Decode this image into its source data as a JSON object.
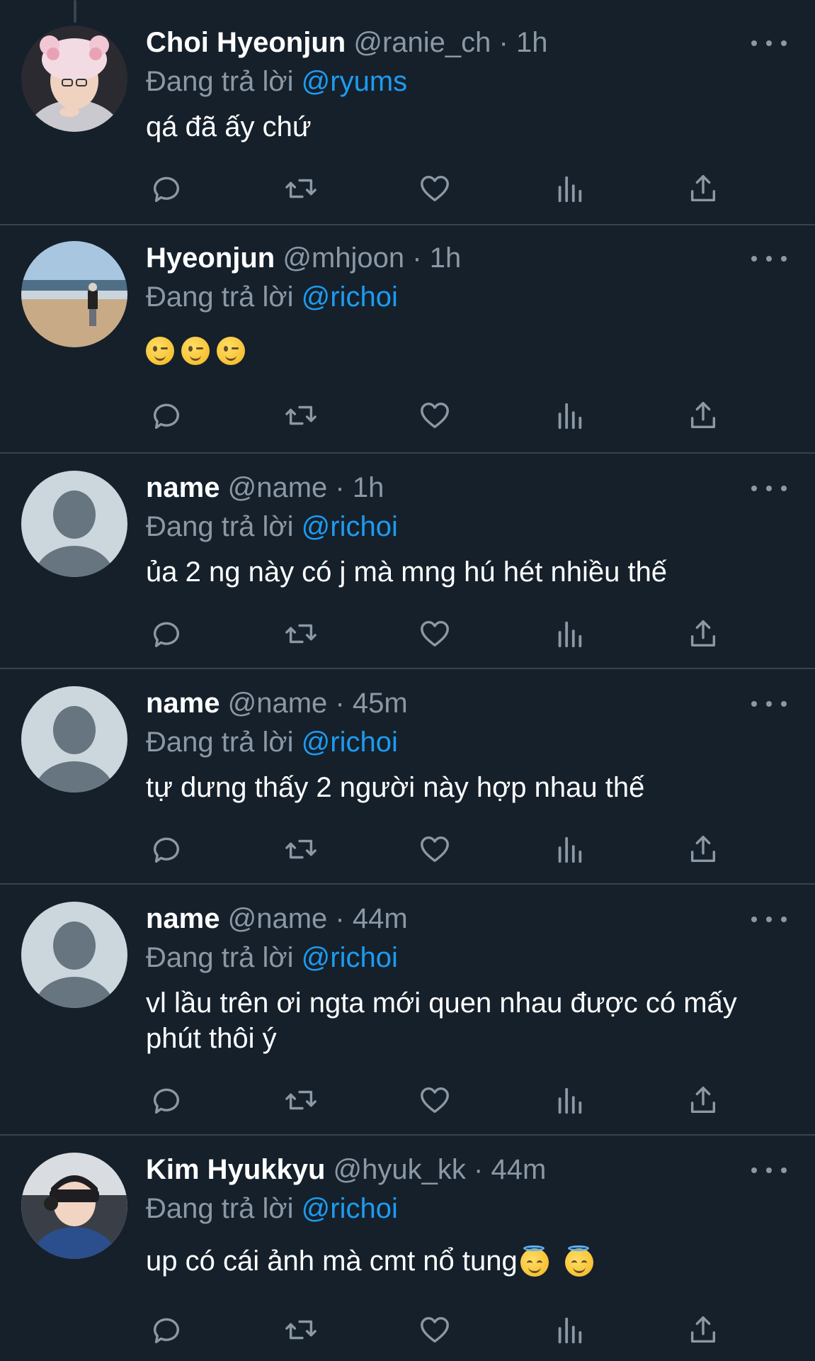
{
  "tweets": [
    {
      "name": "Choi Hyeonjun",
      "handle": "@ranie_ch",
      "sep": "·",
      "time": "1h",
      "reply_prefix": "Đang trả lời",
      "mention": "@ryums",
      "text": "qá đã ấy chứ"
    },
    {
      "name": "Hyeonjun",
      "handle": "@mhjoon",
      "sep": "·",
      "time": "1h",
      "reply_prefix": "Đang trả lời",
      "mention": "@richoi",
      "text": ""
    },
    {
      "name": "name",
      "handle": "@name",
      "sep": "·",
      "time": "1h",
      "reply_prefix": "Đang trả lời",
      "mention": "@richoi",
      "text": "ủa 2 ng này có j mà mng hú hét nhiều thế"
    },
    {
      "name": "name",
      "handle": "@name",
      "sep": "·",
      "time": "45m",
      "reply_prefix": "Đang trả lời",
      "mention": "@richoi",
      "text": "tự dưng thấy 2 người này hợp nhau thế"
    },
    {
      "name": "name",
      "handle": "@name",
      "sep": "·",
      "time": "44m",
      "reply_prefix": "Đang trả lời",
      "mention": "@richoi",
      "text": "vl lầu trên ơi ngta mới quen nhau được có mấy phút thôi ý"
    },
    {
      "name": "Kim Hyukkyu",
      "handle": "@hyuk_kk",
      "sep": "·",
      "time": "44m",
      "reply_prefix": "Đang trả lời",
      "mention": "@richoi",
      "text": "up có cái ảnh mà cmt nổ tung"
    }
  ],
  "icons": [
    "reply-icon",
    "retweet-icon",
    "like-icon",
    "views-icon",
    "share-icon",
    "more-icon"
  ],
  "colors": {
    "background": "#15202b",
    "mention": "#1d9bf0",
    "muted": "#8b98a5",
    "divider": "#38444d"
  }
}
